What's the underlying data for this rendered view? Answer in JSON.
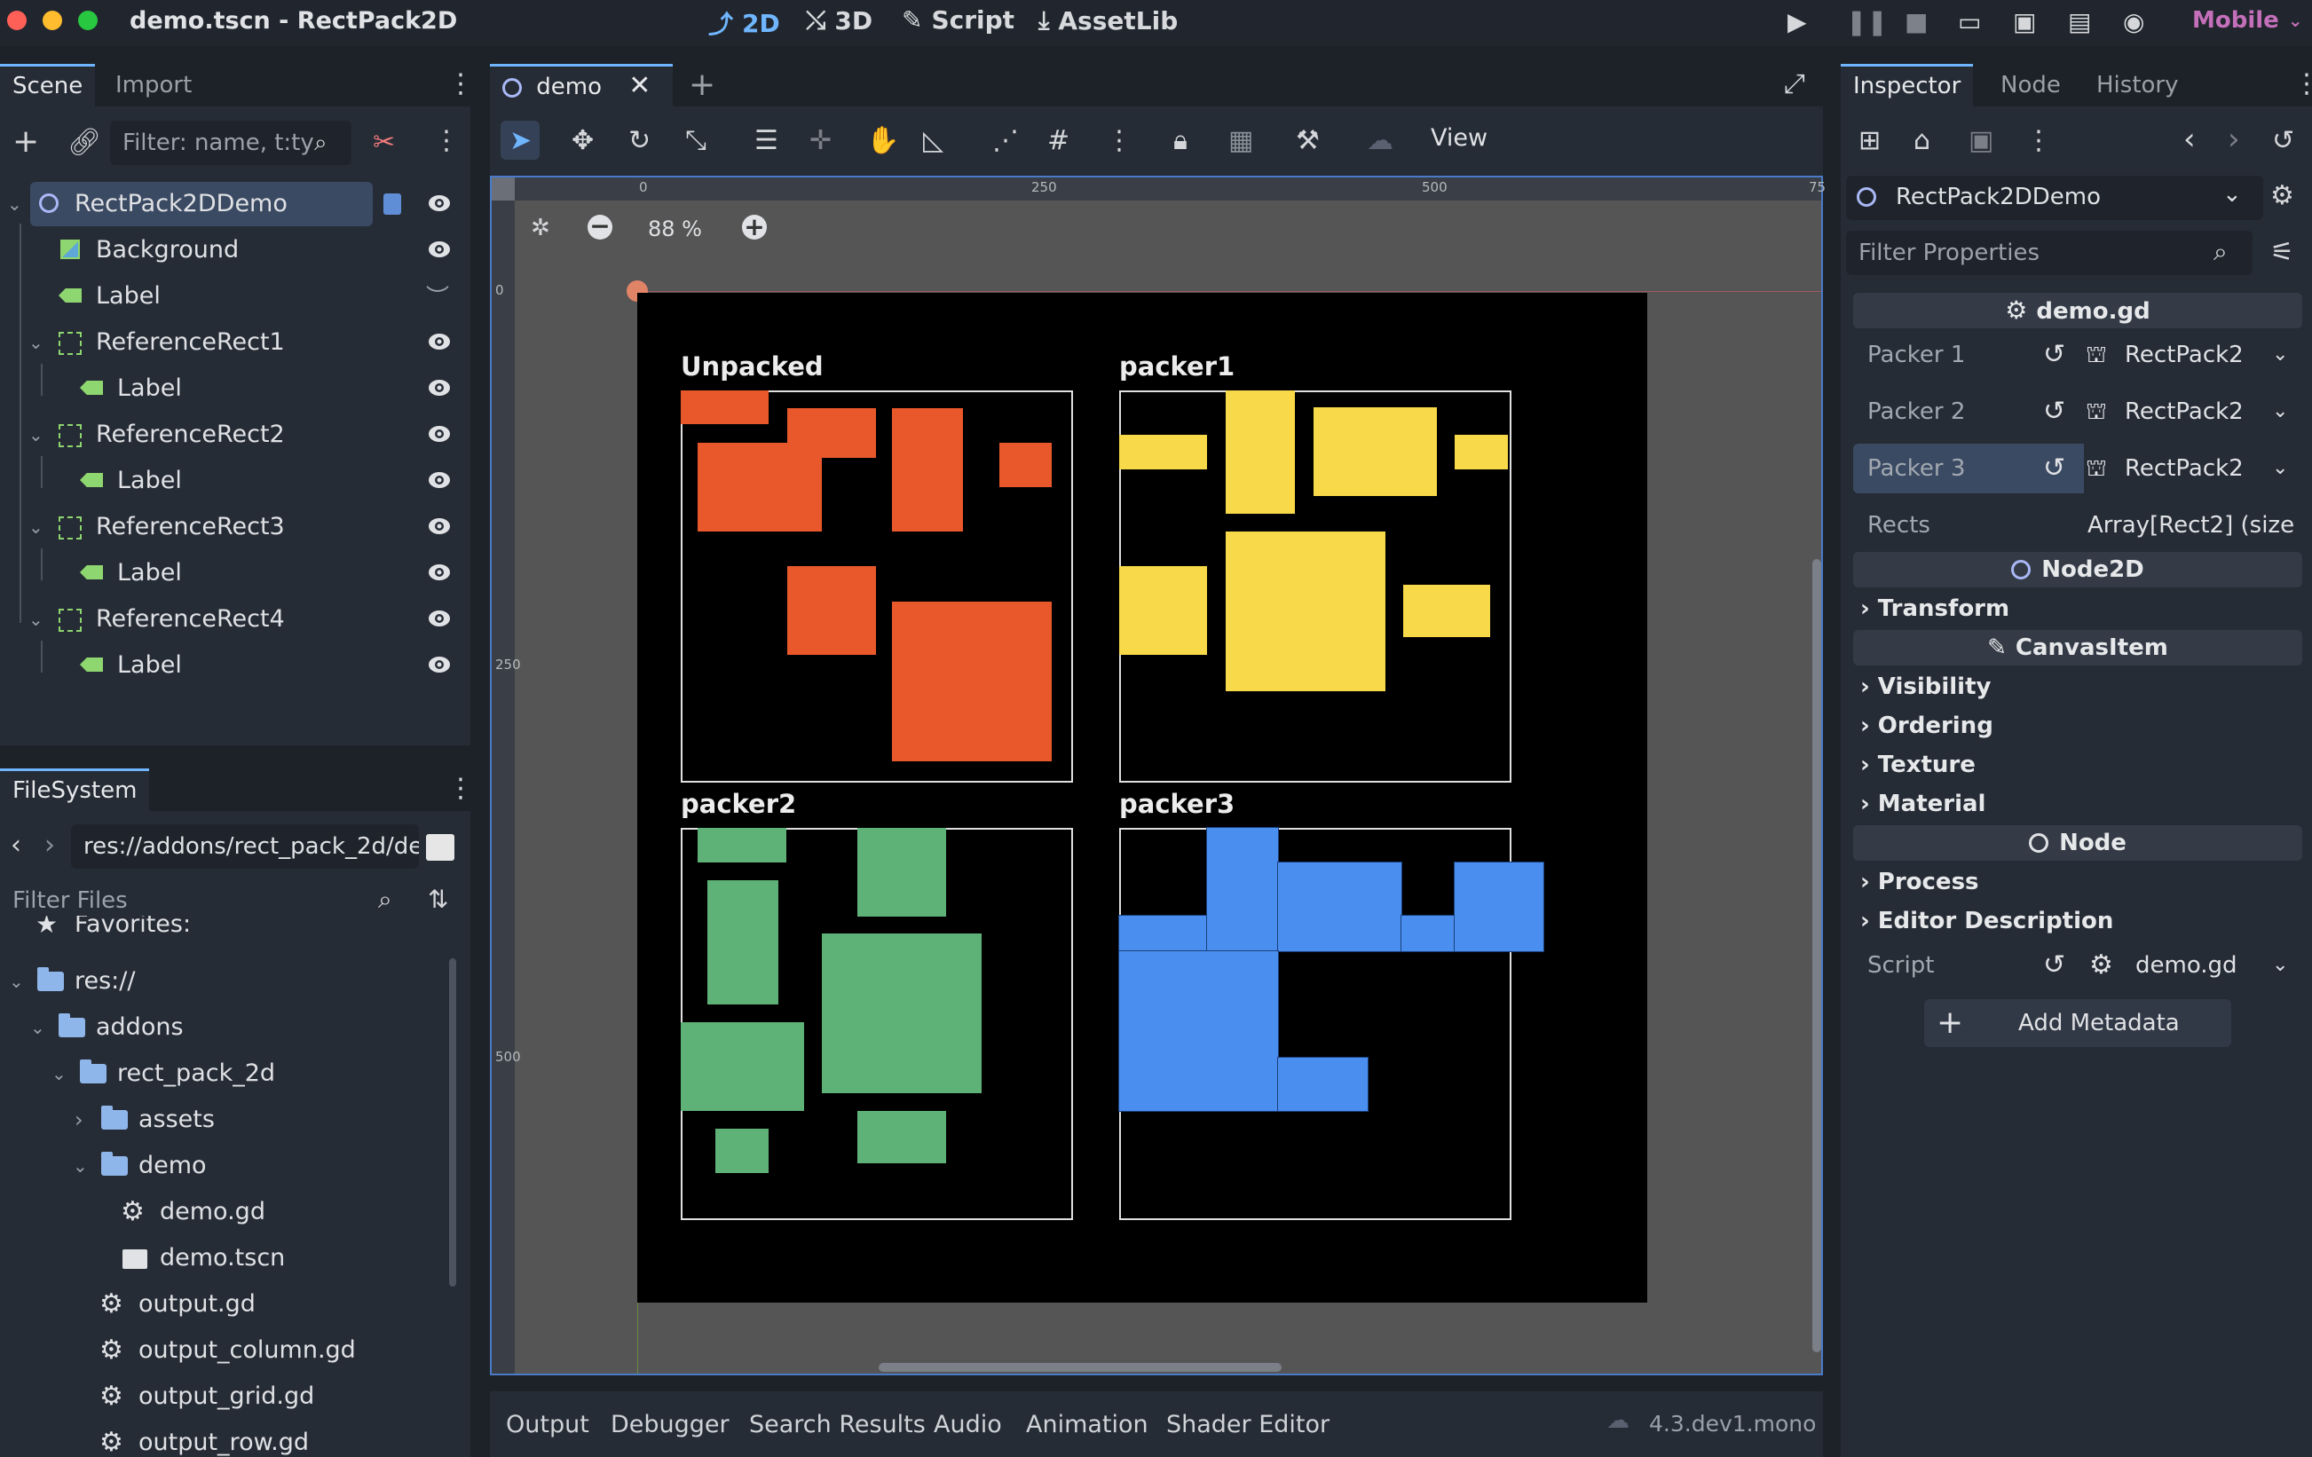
{
  "window": {
    "title": "demo.tscn - RectPack2D",
    "workspaces": [
      {
        "label": "2D",
        "icon": "2d-workspace-icon",
        "active": true
      },
      {
        "label": "3D",
        "icon": "3d-workspace-icon",
        "active": false
      },
      {
        "label": "Script",
        "icon": "script-workspace-icon",
        "active": false
      },
      {
        "label": "AssetLib",
        "icon": "assetlib-icon",
        "active": false
      }
    ],
    "renderer": "Mobile"
  },
  "scene_dock": {
    "tabs": [
      "Scene",
      "Import"
    ],
    "filter_placeholder": "Filter: name, t:ty",
    "tree": [
      {
        "label": "RectPack2DDemo",
        "icon": "node2d-icon",
        "depth": 0,
        "selected": true,
        "has_script": true
      },
      {
        "label": "Background",
        "icon": "texture-rect-icon",
        "depth": 1
      },
      {
        "label": "Label",
        "icon": "label-icon",
        "depth": 1,
        "hidden": true
      },
      {
        "label": "ReferenceRect1",
        "icon": "reference-rect-icon",
        "depth": 1
      },
      {
        "label": "Label",
        "icon": "label-icon",
        "depth": 2
      },
      {
        "label": "ReferenceRect2",
        "icon": "reference-rect-icon",
        "depth": 1
      },
      {
        "label": "Label",
        "icon": "label-icon",
        "depth": 2
      },
      {
        "label": "ReferenceRect3",
        "icon": "reference-rect-icon",
        "depth": 1
      },
      {
        "label": "Label",
        "icon": "label-icon",
        "depth": 2
      },
      {
        "label": "ReferenceRect4",
        "icon": "reference-rect-icon",
        "depth": 1
      },
      {
        "label": "Label",
        "icon": "label-icon",
        "depth": 2
      }
    ]
  },
  "filesystem_dock": {
    "tab": "FileSystem",
    "path": "res://addons/rect_pack_2d/de",
    "filter_placeholder": "Filter Files",
    "items": [
      {
        "label": "Favorites:",
        "type": "favorites",
        "depth": 0
      },
      {
        "label": "res://",
        "type": "folder",
        "depth": 0
      },
      {
        "label": "addons",
        "type": "folder",
        "depth": 1
      },
      {
        "label": "rect_pack_2d",
        "type": "folder",
        "depth": 2
      },
      {
        "label": "assets",
        "type": "folder",
        "depth": 3,
        "collapsed": true
      },
      {
        "label": "demo",
        "type": "folder",
        "depth": 3
      },
      {
        "label": "demo.gd",
        "type": "script",
        "depth": 4
      },
      {
        "label": "demo.tscn",
        "type": "scene",
        "depth": 4
      },
      {
        "label": "output.gd",
        "type": "script",
        "depth": 3
      },
      {
        "label": "output_column.gd",
        "type": "script",
        "depth": 3
      },
      {
        "label": "output_grid.gd",
        "type": "script",
        "depth": 3
      },
      {
        "label": "output_row.gd",
        "type": "script",
        "depth": 3
      }
    ]
  },
  "editor": {
    "tab": "demo",
    "view_menu": "View",
    "zoom": "88 %",
    "ruler_labels": {
      "h": [
        "0",
        "250",
        "500",
        "75"
      ],
      "v": [
        "0",
        "250",
        "500"
      ]
    },
    "bottom_tabs": [
      "Output",
      "Debugger",
      "Search Results",
      "Audio",
      "Animation",
      "Shader Editor"
    ],
    "version": "4.3.dev1.mono"
  },
  "canvas": {
    "boxes": [
      {
        "title": "Unpacked",
        "color": "#e9582b",
        "rects": [
          [
            0,
            0,
            79,
            30
          ],
          [
            96,
            16,
            176,
            61
          ],
          [
            15,
            47,
            127,
            127
          ],
          [
            190,
            16,
            254,
            127
          ],
          [
            287,
            47,
            334,
            87
          ],
          [
            96,
            158,
            176,
            238
          ],
          [
            190,
            190,
            334,
            334
          ]
        ]
      },
      {
        "title": "packer1",
        "color": "#f8d94a",
        "rects": [
          [
            0,
            40,
            79,
            71
          ],
          [
            96,
            0,
            158,
            111
          ],
          [
            175,
            15,
            286,
            95
          ],
          [
            302,
            40,
            350,
            71
          ],
          [
            0,
            158,
            79,
            238
          ],
          [
            96,
            127,
            240,
            271
          ],
          [
            256,
            175,
            334,
            222
          ]
        ]
      },
      {
        "title": "packer2",
        "color": "#5fb277",
        "rects": [
          [
            15,
            0,
            95,
            31
          ],
          [
            159,
            0,
            239,
            80
          ],
          [
            24,
            47,
            88,
            159
          ],
          [
            127,
            95,
            271,
            239
          ],
          [
            0,
            175,
            111,
            255
          ],
          [
            31,
            271,
            79,
            311
          ],
          [
            159,
            255,
            239,
            302
          ]
        ]
      },
      {
        "title": "packer3",
        "color": "#4a8ff0",
        "rects": [
          [
            0,
            79,
            79,
            111
          ],
          [
            79,
            0,
            143,
            111
          ],
          [
            143,
            31,
            254,
            111
          ],
          [
            254,
            79,
            302,
            111
          ],
          [
            302,
            31,
            382,
            111
          ],
          [
            0,
            111,
            143,
            255
          ],
          [
            143,
            207,
            224,
            255
          ]
        ]
      }
    ]
  },
  "inspector": {
    "tabs": [
      "Inspector",
      "Node",
      "History"
    ],
    "node_name": "RectPack2DDemo",
    "filter_placeholder": "Filter Properties",
    "script_section": "demo.gd",
    "properties": [
      {
        "name": "Packer 1",
        "value": "RectPack2"
      },
      {
        "name": "Packer 2",
        "value": "RectPack2"
      },
      {
        "name": "Packer 3",
        "value": "RectPack2",
        "highlighted": true
      }
    ],
    "rects": {
      "name": "Rects",
      "value": "Array[Rect2] (size"
    },
    "node2d_section": "Node2D",
    "transform": "Transform",
    "canvasitem_section": "CanvasItem",
    "canvas_categories": [
      "Visibility",
      "Ordering",
      "Texture",
      "Material"
    ],
    "node_section": "Node",
    "node_categories": [
      "Process",
      "Editor Description"
    ],
    "script_prop": {
      "name": "Script",
      "value": "demo.gd"
    },
    "add_metadata": "Add Metadata"
  },
  "colors": {
    "accent": "#70b6ff",
    "panel": "#262c36",
    "background": "#1d2229",
    "selection": "#3b4a63"
  }
}
